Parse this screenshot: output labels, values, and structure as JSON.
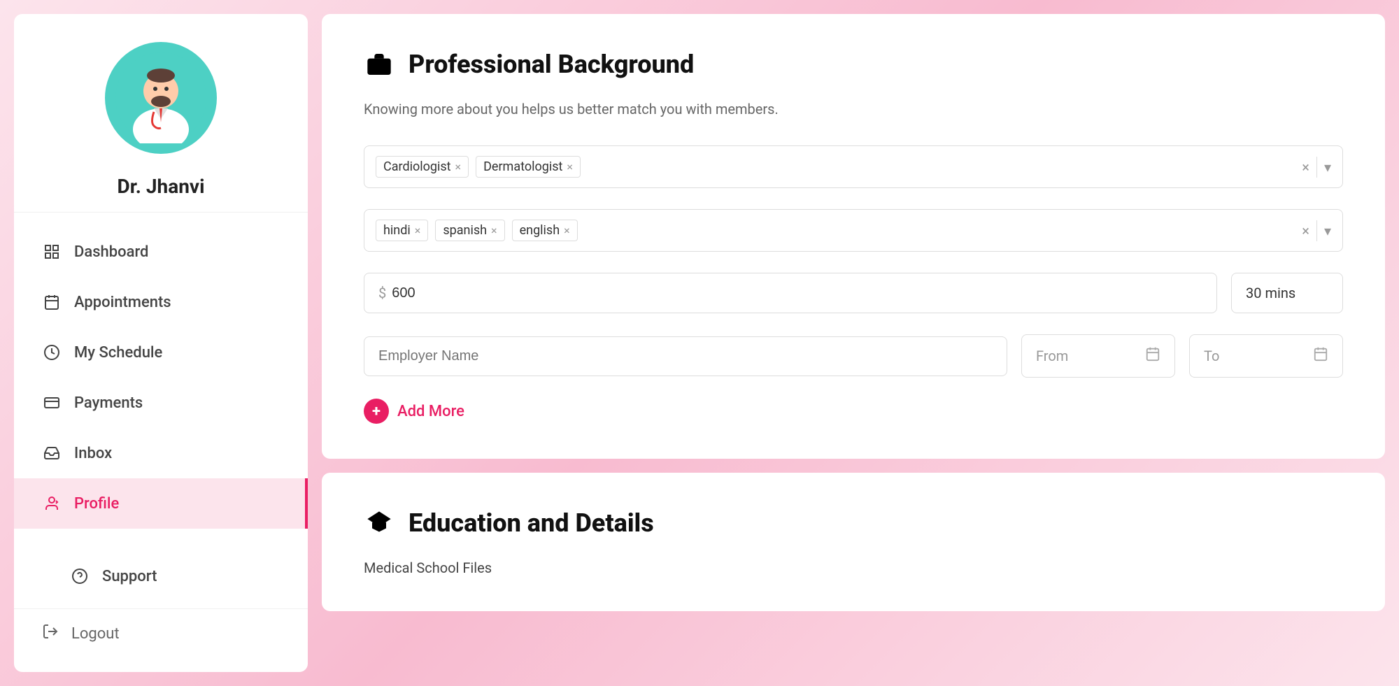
{
  "sidebar": {
    "doctor_name": "Dr. Jhanvi",
    "nav_items": [
      {
        "id": "dashboard",
        "label": "Dashboard",
        "icon": "dashboard-icon",
        "active": false
      },
      {
        "id": "appointments",
        "label": "Appointments",
        "icon": "appointments-icon",
        "active": false
      },
      {
        "id": "my-schedule",
        "label": "My Schedule",
        "icon": "schedule-icon",
        "active": false
      },
      {
        "id": "payments",
        "label": "Payments",
        "icon": "payments-icon",
        "active": false
      },
      {
        "id": "inbox",
        "label": "Inbox",
        "icon": "inbox-icon",
        "active": false
      },
      {
        "id": "profile",
        "label": "Profile",
        "icon": "profile-icon",
        "active": true
      }
    ],
    "support": {
      "label": "Support",
      "icon": "support-icon"
    },
    "logout": {
      "label": "Logout",
      "icon": "logout-icon"
    }
  },
  "professional_background": {
    "section_title": "Professional Background",
    "section_subtitle": "Knowing more about you helps us better match you with members.",
    "specializations": {
      "tags": [
        "Cardiologist",
        "Dermatologist"
      ]
    },
    "languages": {
      "tags": [
        "hindi",
        "spanish",
        "english"
      ]
    },
    "consultation_fee": {
      "currency": "$",
      "value": "600"
    },
    "consultation_duration": "30 mins",
    "work_experience": {
      "employer_placeholder": "Employer Name",
      "from_label": "From",
      "to_label": "To"
    },
    "add_more_label": "Add More"
  },
  "education": {
    "section_title": "Education and Details",
    "medical_school_label": "Medical School Files"
  },
  "colors": {
    "primary": "#e91e63",
    "active_bg": "#fce4ec",
    "teal": "#4dd0c4"
  }
}
